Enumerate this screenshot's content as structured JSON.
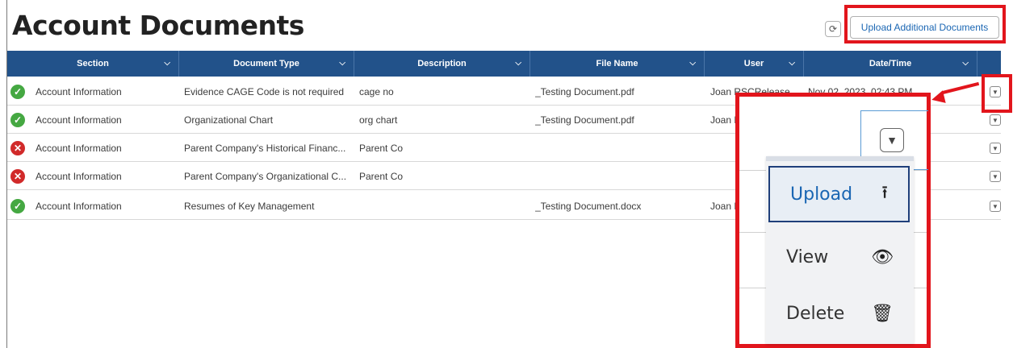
{
  "page": {
    "title": "Account Documents"
  },
  "toolbar": {
    "refresh_icon": "refresh-icon",
    "upload_additional_label": "Upload Additional Documents"
  },
  "table": {
    "columns": [
      "Section",
      "Document Type",
      "Description",
      "File Name",
      "User",
      "Date/Time"
    ],
    "rows": [
      {
        "status": "complete",
        "section": "Account Information",
        "doc_type": "Evidence CAGE Code is not required",
        "description": "cage no",
        "file_name": "_Testing Document.pdf",
        "user": "Joan RSCRelease...",
        "datetime": "Nov 02, 2023, 02:43 PM"
      },
      {
        "status": "complete",
        "section": "Account Information",
        "doc_type": "Organizational Chart",
        "description": "org chart",
        "file_name": "_Testing Document.pdf",
        "user": "Joan R",
        "datetime": ""
      },
      {
        "status": "missing",
        "section": "Account Information",
        "doc_type": "Parent Company's Historical Financ...",
        "description": "Parent Co",
        "file_name": "",
        "user": "",
        "datetime": ""
      },
      {
        "status": "missing",
        "section": "Account Information",
        "doc_type": "Parent Company's Organizational C...",
        "description": "Parent Co",
        "file_name": "",
        "user": "",
        "datetime": ""
      },
      {
        "status": "complete",
        "section": "Account Information",
        "doc_type": "Resumes of Key Management",
        "description": "",
        "file_name": "_Testing Document.docx",
        "user": "Joan R",
        "datetime": ""
      }
    ]
  },
  "row_menu": {
    "items": [
      {
        "label": "Upload",
        "icon": "upload-icon"
      },
      {
        "label": "View",
        "icon": "eye-icon"
      },
      {
        "label": "Delete",
        "icon": "trash-icon"
      }
    ]
  },
  "colors": {
    "header_bg": "#22528a",
    "highlight_red": "#e2151c",
    "success_green": "#45a842",
    "error_red": "#d12a2a",
    "link_blue": "#1a66b3"
  }
}
